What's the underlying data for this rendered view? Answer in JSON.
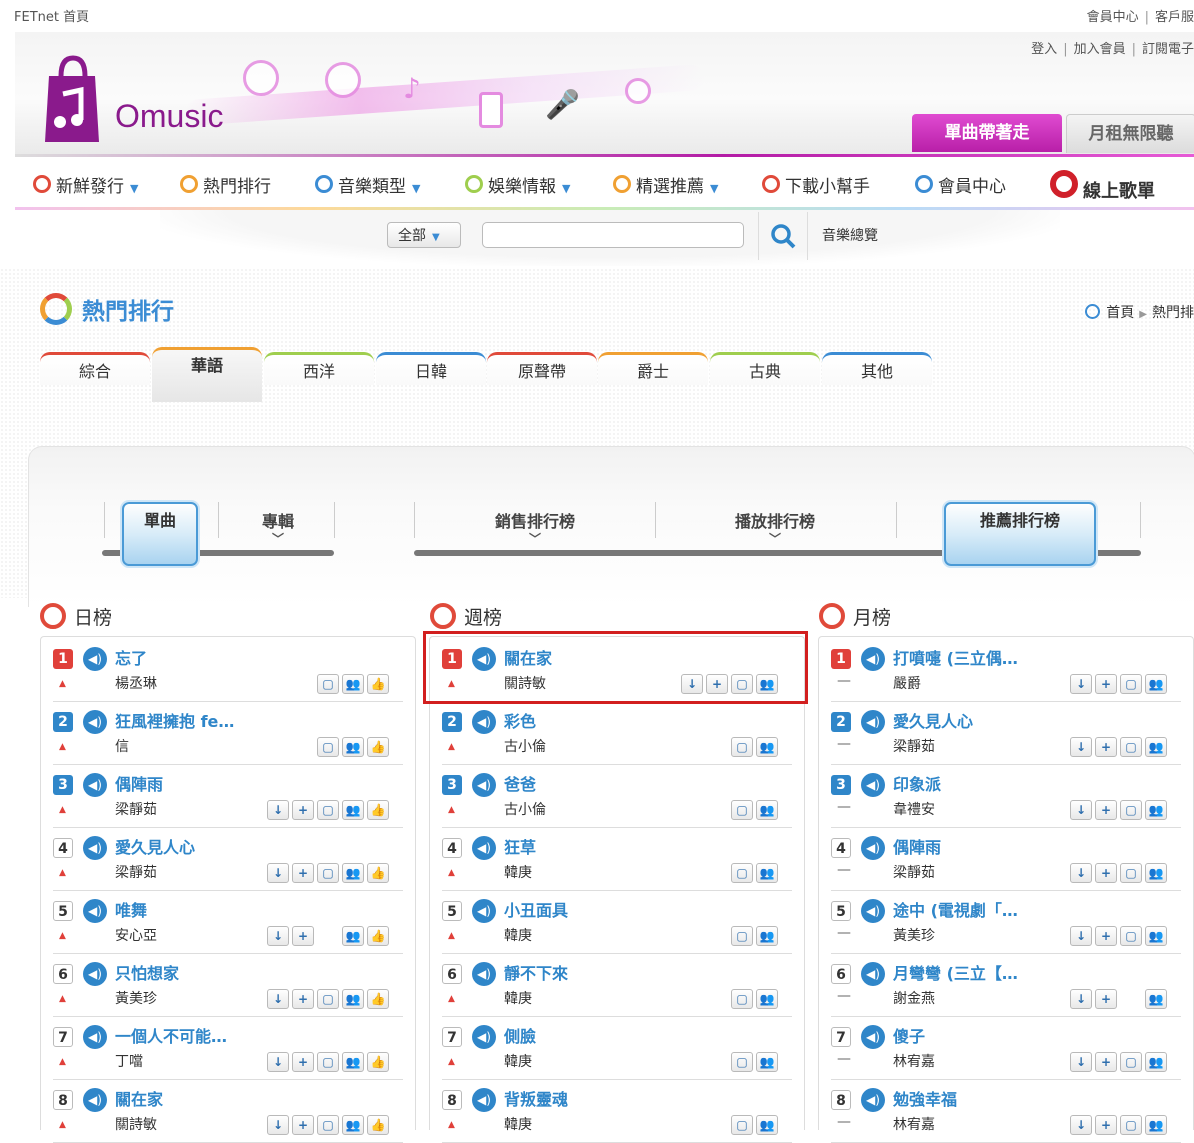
{
  "topbar": {
    "site": "FETnet 首頁",
    "right": [
      "會員中心",
      "客戶服"
    ]
  },
  "header": {
    "login_links": [
      "登入",
      "加入會員",
      "訂閱電子"
    ],
    "logo_text": "Omusic",
    "tab_active": "單曲帶著走",
    "tab_inactive": "月租無限聽"
  },
  "nav": {
    "items": [
      "新鮮發行",
      "熱門排行",
      "音樂類型",
      "娛樂情報",
      "精選推薦",
      "下載小幫手",
      "會員中心",
      "線上歌單"
    ]
  },
  "search": {
    "scope": "全部",
    "value": "",
    "all_link": "音樂總覽"
  },
  "page": {
    "title": "熱門排行",
    "breadcrumb": [
      "首頁",
      "熱門排"
    ]
  },
  "genre_tabs": [
    "綜合",
    "華語",
    "西洋",
    "日韓",
    "原聲帶",
    "爵士",
    "古典",
    "其他"
  ],
  "genre_active": "華語",
  "toggles": {
    "type": [
      "單曲",
      "專輯"
    ],
    "charts": [
      "銷售排行榜",
      "播放排行榜",
      "推薦排行榜"
    ]
  },
  "columns": {
    "daily": {
      "title": "日榜",
      "entries": [
        {
          "rank": "1",
          "song": "忘了",
          "artist": "楊丞琳"
        },
        {
          "rank": "2",
          "song": "狂風裡擁抱 fe…",
          "artist": "信"
        },
        {
          "rank": "3",
          "song": "偶陣雨",
          "artist": "梁靜茹"
        },
        {
          "rank": "4",
          "song": "愛久見人心",
          "artist": "梁靜茹"
        },
        {
          "rank": "5",
          "song": "唯舞",
          "artist": "安心亞"
        },
        {
          "rank": "6",
          "song": "只怕想家",
          "artist": "黃美珍"
        },
        {
          "rank": "7",
          "song": "一個人不可能…",
          "artist": "丁噹"
        },
        {
          "rank": "8",
          "song": "關在家",
          "artist": "關詩敏"
        }
      ]
    },
    "weekly": {
      "title": "週榜",
      "entries": [
        {
          "rank": "1",
          "song": "關在家",
          "artist": "關詩敏"
        },
        {
          "rank": "2",
          "song": "彩色",
          "artist": "古小倫"
        },
        {
          "rank": "3",
          "song": "爸爸",
          "artist": "古小倫"
        },
        {
          "rank": "4",
          "song": "狂草",
          "artist": "韓庚"
        },
        {
          "rank": "5",
          "song": "小丑面具",
          "artist": "韓庚"
        },
        {
          "rank": "6",
          "song": "靜不下來",
          "artist": "韓庚"
        },
        {
          "rank": "7",
          "song": "側臉",
          "artist": "韓庚"
        },
        {
          "rank": "8",
          "song": "背叛靈魂",
          "artist": "韓庚"
        }
      ]
    },
    "monthly": {
      "title": "月榜",
      "entries": [
        {
          "rank": "1",
          "song": "打噴嚏 (三立偶…",
          "artist": "嚴爵"
        },
        {
          "rank": "2",
          "song": "愛久見人心",
          "artist": "梁靜茹"
        },
        {
          "rank": "3",
          "song": "印象派",
          "artist": "韋禮安"
        },
        {
          "rank": "4",
          "song": "偶陣雨",
          "artist": "梁靜茹"
        },
        {
          "rank": "5",
          "song": "途中 (電視劇「…",
          "artist": "黃美珍"
        },
        {
          "rank": "6",
          "song": "月彎彎 (三立【…",
          "artist": "謝金燕"
        },
        {
          "rank": "7",
          "song": "傻子",
          "artist": "林宥嘉"
        },
        {
          "rank": "8",
          "song": "勉強幸福",
          "artist": "林宥嘉"
        }
      ]
    }
  },
  "colors": {
    "accent_blue": "#2f86c9",
    "rank_red": "#e0403a",
    "brand_purple": "#b81fa8"
  }
}
